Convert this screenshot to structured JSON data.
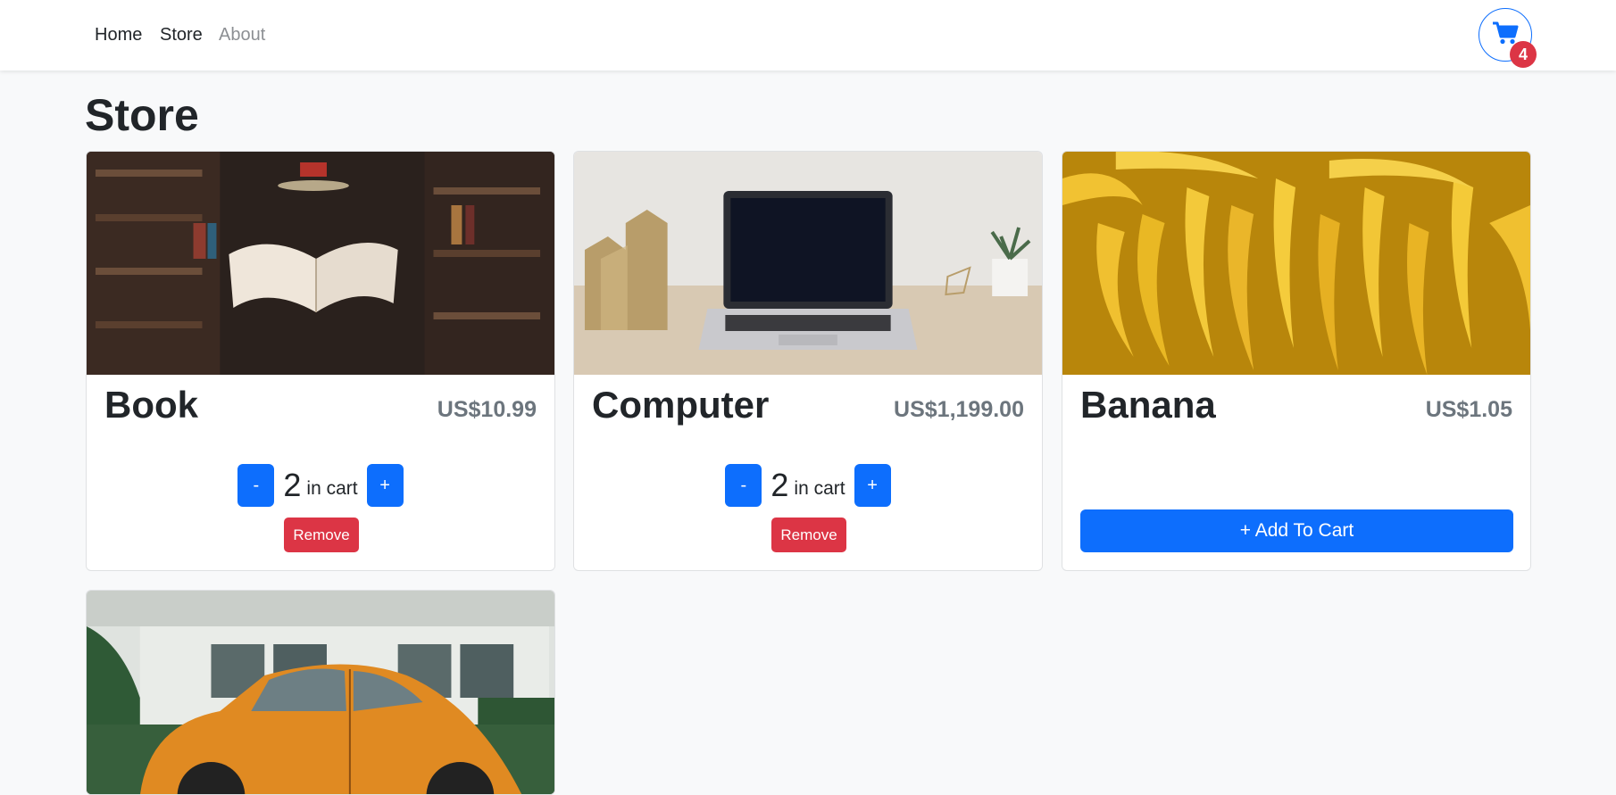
{
  "nav": {
    "links": [
      {
        "label": "Home"
      },
      {
        "label": "Store"
      },
      {
        "label": "About"
      }
    ]
  },
  "cart": {
    "count": "4",
    "icon": "cart-icon",
    "accent": "#0d6efd",
    "badge_color": "#dc3545"
  },
  "page": {
    "title": "Store"
  },
  "products": [
    {
      "name": "Book",
      "price": "US$10.99",
      "quantity": "2",
      "in_cart_label": "in cart",
      "decrement_label": "-",
      "increment_label": "+",
      "remove_label": "Remove"
    },
    {
      "name": "Computer",
      "price": "US$1,199.00",
      "quantity": "2",
      "in_cart_label": "in cart",
      "decrement_label": "-",
      "increment_label": "+",
      "remove_label": "Remove"
    },
    {
      "name": "Banana",
      "price": "US$1.05",
      "add_label": "+ Add To Cart"
    },
    {}
  ]
}
